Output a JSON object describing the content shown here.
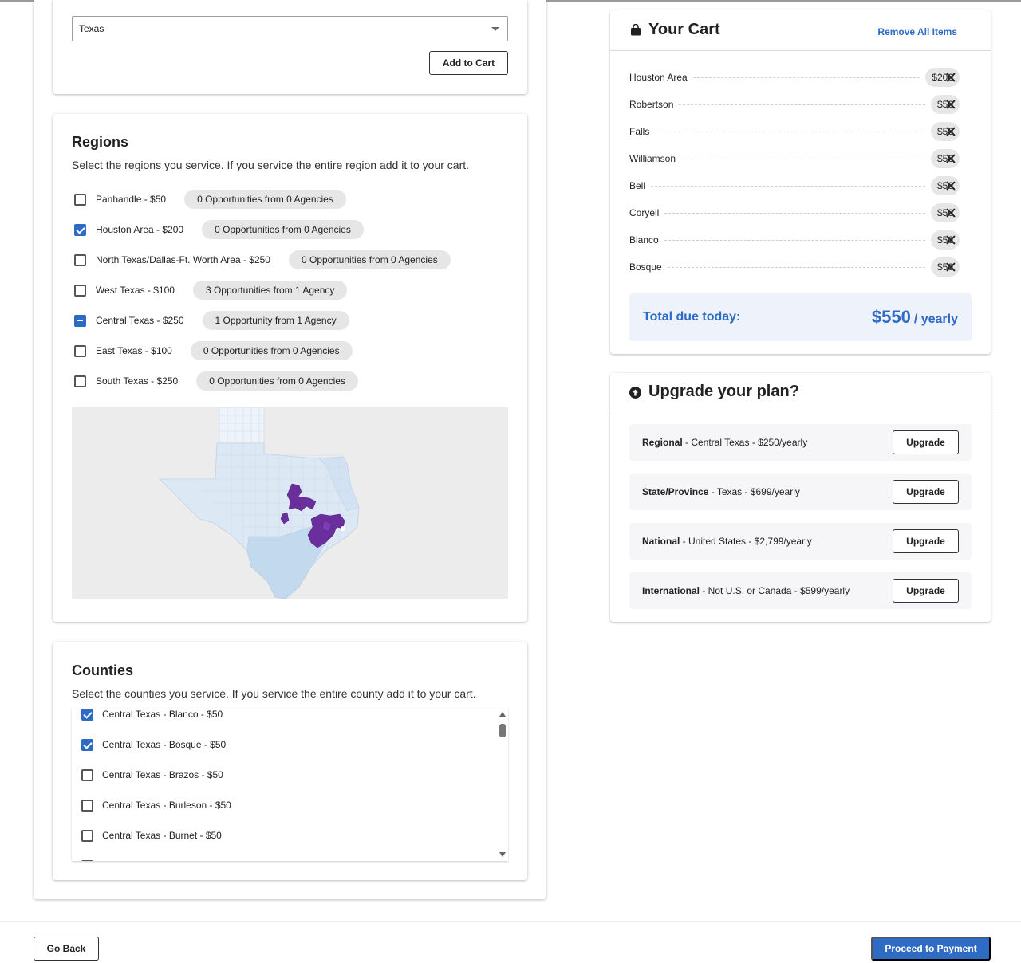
{
  "state_select": {
    "value": "Texas",
    "add_to_cart_label": "Add to Cart"
  },
  "regions": {
    "title": "Regions",
    "description": "Select the regions you service. If you service the entire region add it to your cart.",
    "items": [
      {
        "label": "Panhandle - $50",
        "state": "unchecked",
        "opportunities": "0 Opportunities from 0 Agencies"
      },
      {
        "label": "Houston Area - $200",
        "state": "checked",
        "opportunities": "0 Opportunities from 0 Agencies"
      },
      {
        "label": "North Texas/Dallas-Ft. Worth Area - $250",
        "state": "unchecked",
        "opportunities": "0 Opportunities from 0 Agencies"
      },
      {
        "label": "West Texas - $100",
        "state": "unchecked",
        "opportunities": "3 Opportunities from 1 Agency"
      },
      {
        "label": "Central Texas - $250",
        "state": "indeterminate",
        "opportunities": "1 Opportunity from 1 Agency"
      },
      {
        "label": "East Texas - $100",
        "state": "unchecked",
        "opportunities": "0 Opportunities from 0 Agencies"
      },
      {
        "label": "South Texas - $250",
        "state": "unchecked",
        "opportunities": "0 Opportunities from 0 Agencies"
      }
    ],
    "map_colors": {
      "background": "#ececec",
      "unselected": "#dde8f5",
      "region_south": "#c3d9ee",
      "selected": "#6a2f9c"
    }
  },
  "counties": {
    "title": "Counties",
    "description": "Select the counties you service. If you service the entire county add it to your cart.",
    "items": [
      {
        "label": "Central Texas - Blanco - $50",
        "state": "checked"
      },
      {
        "label": "Central Texas - Bosque - $50",
        "state": "checked"
      },
      {
        "label": "Central Texas - Brazos - $50",
        "state": "unchecked"
      },
      {
        "label": "Central Texas - Burleson - $50",
        "state": "unchecked"
      },
      {
        "label": "Central Texas - Burnet - $50",
        "state": "unchecked"
      }
    ]
  },
  "cart": {
    "title": "Your Cart",
    "icon": "shopping-bag-icon",
    "remove_all_label": "Remove All Items",
    "items": [
      {
        "name": "Houston Area",
        "price": "$200"
      },
      {
        "name": "Robertson",
        "price": "$50"
      },
      {
        "name": "Falls",
        "price": "$50"
      },
      {
        "name": "Williamson",
        "price": "$50"
      },
      {
        "name": "Bell",
        "price": "$50"
      },
      {
        "name": "Coryell",
        "price": "$50"
      },
      {
        "name": "Blanco",
        "price": "$50"
      },
      {
        "name": "Bosque",
        "price": "$50"
      }
    ],
    "total_label": "Total due today:",
    "total_amount": "$550",
    "total_period": "/ yearly"
  },
  "upgrade": {
    "title": "Upgrade your plan?",
    "icon": "arrow-up-circle-icon",
    "plans": [
      {
        "name": "Regional",
        "detail": " - Central Texas - $250/yearly",
        "button": "Upgrade"
      },
      {
        "name": "State/Province",
        "detail": " - Texas - $699/yearly",
        "button": "Upgrade"
      },
      {
        "name": "National",
        "detail": " - United States - $2,799/yearly",
        "button": "Upgrade"
      },
      {
        "name": "International",
        "detail": " - Not U.S. or Canada - $599/yearly",
        "button": "Upgrade"
      }
    ]
  },
  "footer": {
    "go_back_label": "Go Back",
    "proceed_label": "Proceed to Payment"
  },
  "colors": {
    "accent": "#2e6bc4",
    "pill": "#e6e6e6",
    "total_bg": "#eef2fb"
  }
}
